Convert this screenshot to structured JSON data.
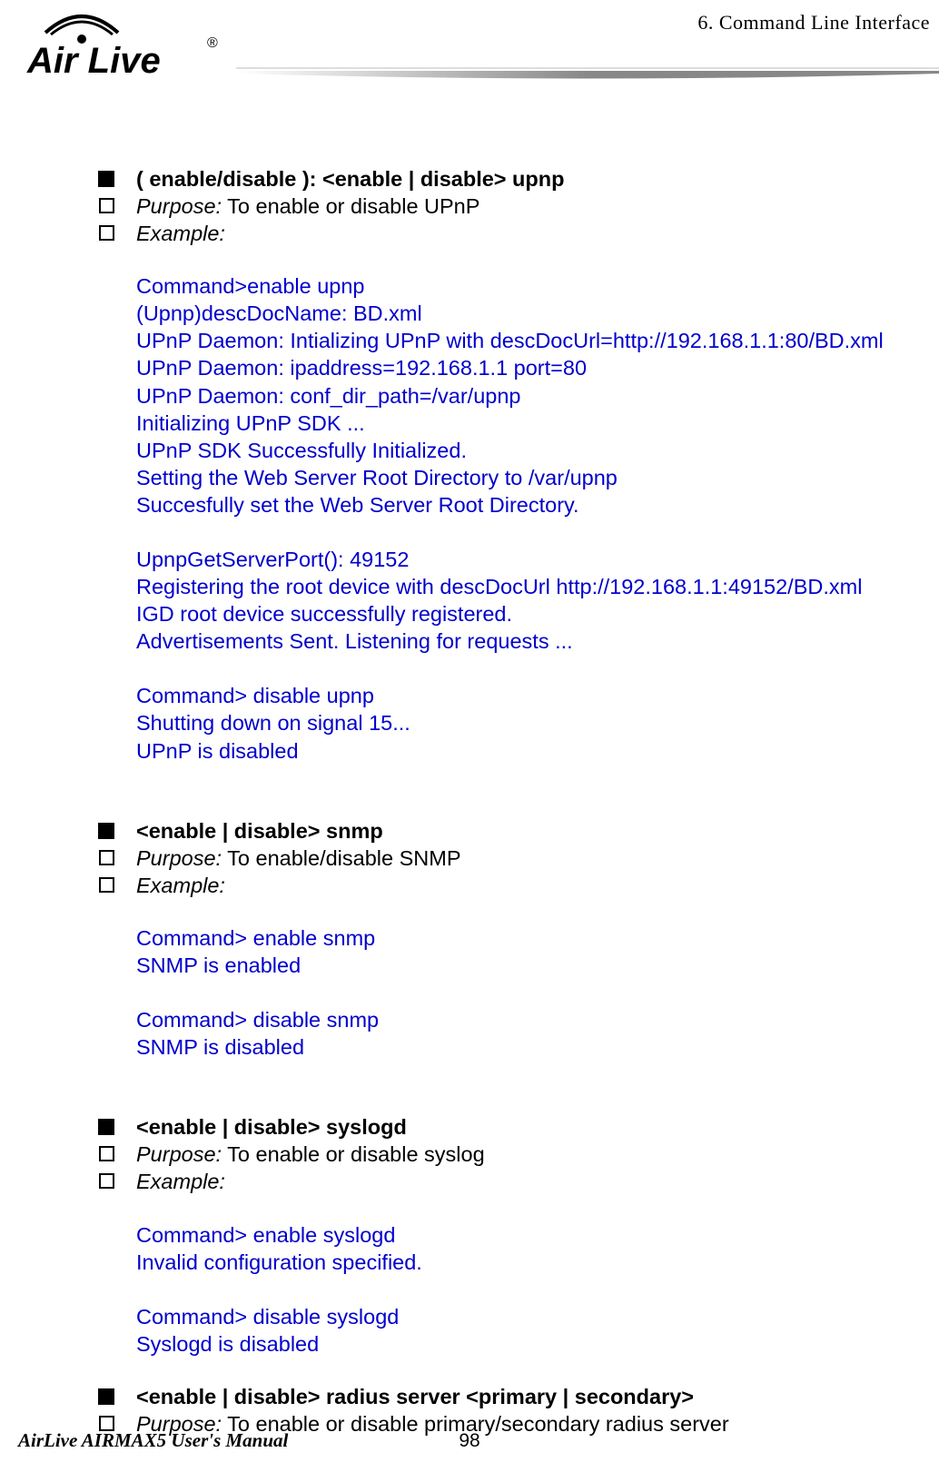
{
  "header": {
    "chapter": "6.    Command  Line  Interface",
    "logo_brand": "Air Live",
    "logo_reg": "®"
  },
  "sections": [
    {
      "title": "( enable/disable ):    <enable | disable> upnp",
      "purpose_label": "Purpose:",
      "purpose_text": "    To enable or disable UPnP",
      "example_label": "Example:",
      "code": "Command>enable upnp\n(Upnp)descDocName: BD.xml\nUPnP Daemon: Intializing UPnP with descDocUrl=http://192.168.1.1:80/BD.xml\nUPnP Daemon: ipaddress=192.168.1.1 port=80\nUPnP Daemon: conf_dir_path=/var/upnp\nInitializing UPnP SDK ...\nUPnP SDK Successfully Initialized.\nSetting the Web Server Root Directory to /var/upnp\nSuccesfully set the Web Server Root Directory.\n \nUpnpGetServerPort(): 49152\nRegistering the root device with descDocUrl http://192.168.1.1:49152/BD.xml\nIGD root device successfully registered.\nAdvertisements Sent.    Listening for requests ...\n \nCommand> disable upnp\nShutting down on signal 15...\nUPnP is disabled"
    },
    {
      "title": "<enable | disable> snmp",
      "purpose_label": "Purpose:",
      "purpose_text": " To enable/disable SNMP",
      "example_label": "Example:",
      "code": "Command> enable snmp\nSNMP is enabled\n \nCommand> disable snmp\nSNMP is disabled"
    },
    {
      "title": "<enable | disable> syslogd",
      "purpose_label": "Purpose:",
      "purpose_text": "    To enable or disable syslog",
      "example_label": "Example:",
      "code": "Command> enable syslogd\nInvalid configuration specified.\n \nCommand> disable syslogd\nSyslogd is disabled"
    },
    {
      "title": "<enable | disable> radius server <primary | secondary>",
      "purpose_label": "Purpose:",
      "purpose_text": " To enable or disable primary/secondary radius server"
    }
  ],
  "footer": {
    "manual": "AirLive AIRMAX5 User's Manual",
    "page": "98"
  }
}
